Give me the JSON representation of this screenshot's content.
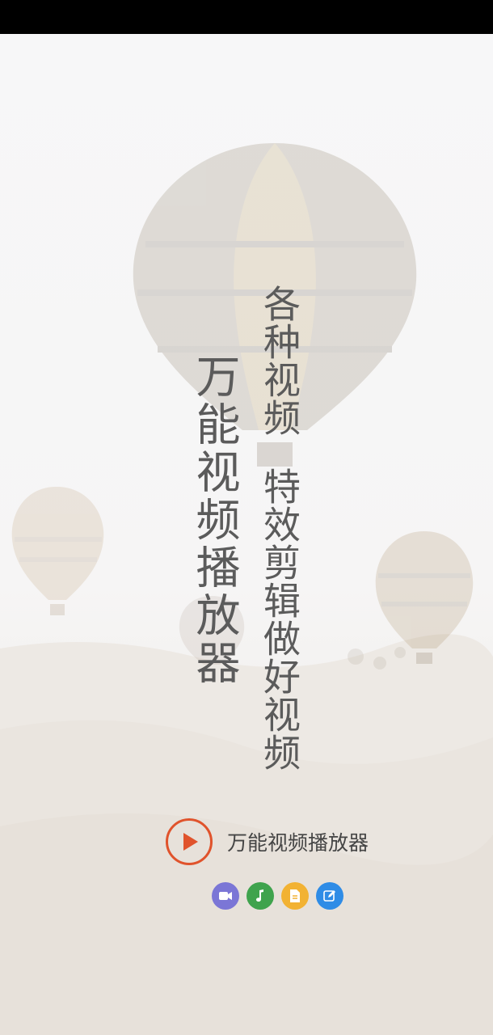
{
  "splash": {
    "poem": {
      "title": "万能视频播放器",
      "line1": "各种视频",
      "line2": "特效剪辑做好视频"
    },
    "brand": {
      "name": "万能视频播放器",
      "logo_color": "#e0532c"
    },
    "feature_icons": [
      {
        "name": "video-camera-icon",
        "color": "#7b76d6"
      },
      {
        "name": "music-note-icon",
        "color": "#3fa34d"
      },
      {
        "name": "document-icon",
        "color": "#f2b233"
      },
      {
        "name": "edit-icon",
        "color": "#2f8ce6"
      }
    ]
  }
}
